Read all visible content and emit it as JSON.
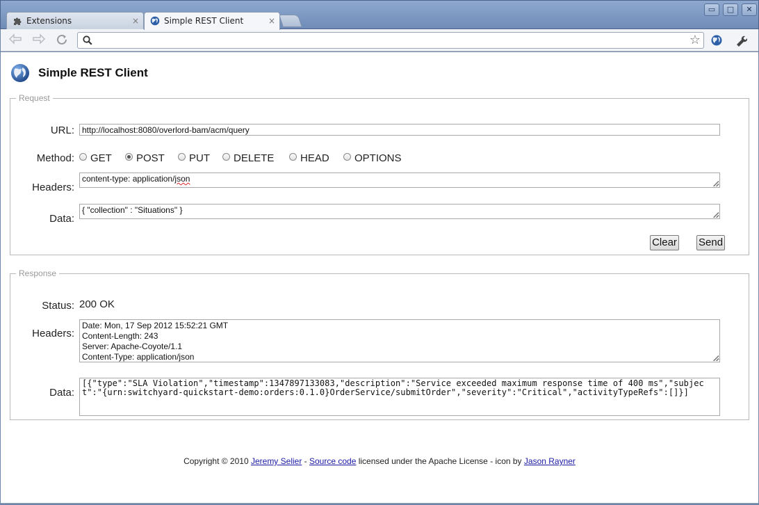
{
  "browser": {
    "tabs": [
      {
        "label": "Extensions",
        "icon": "puzzle-icon",
        "close": "×"
      },
      {
        "label": "Simple REST Client",
        "icon": "globe-icon",
        "close": "×"
      }
    ],
    "window_buttons": {
      "minimize": "▭",
      "maximize": "□",
      "close": "✕"
    },
    "address_value": ""
  },
  "app": {
    "title": "Simple REST Client"
  },
  "request": {
    "legend": "Request",
    "url_label": "URL:",
    "url_value": "http://localhost:8080/overlord-bam/acm/query",
    "method_label": "Method:",
    "methods": [
      "GET",
      "POST",
      "PUT",
      "DELETE",
      "HEAD",
      "OPTIONS"
    ],
    "selected_method": "POST",
    "headers_label": "Headers:",
    "headers_prefix": "content-type: application/",
    "headers_misspelled": "json",
    "data_label": "Data:",
    "data_value": "{ \"collection\" : \"Situations\" }",
    "clear_label": "Clear",
    "send_label": "Send"
  },
  "response": {
    "legend": "Response",
    "status_label": "Status:",
    "status_value": "200 OK",
    "headers_label": "Headers:",
    "headers_lines": [
      "Date: Mon, 17 Sep 2012 15:52:21 GMT",
      "Content-Length: 243",
      "Server: Apache-Coyote/1.1",
      "Content-Type: application/json"
    ],
    "data_label": "Data:",
    "data_value": "[{\"type\":\"SLA Violation\",\"timestamp\":1347897133083,\"description\":\"Service exceeded maximum response time of 400 ms\",\"subject\":\"{urn:switchyard-quickstart-demo:orders:0.1.0}OrderService/submitOrder\",\"severity\":\"Critical\",\"activityTypeRefs\":[]}]"
  },
  "footer": {
    "prefix": "Copyright © 2010 ",
    "author_link": "Jeremy Selier",
    "sep": " - ",
    "source_link": "Source code",
    "license_text": " licensed under the Apache License - icon by ",
    "icon_author_link": "Jason Rayner"
  },
  "colors": {
    "link": "#1a1aa6",
    "title_bar": "#7a94bf"
  }
}
